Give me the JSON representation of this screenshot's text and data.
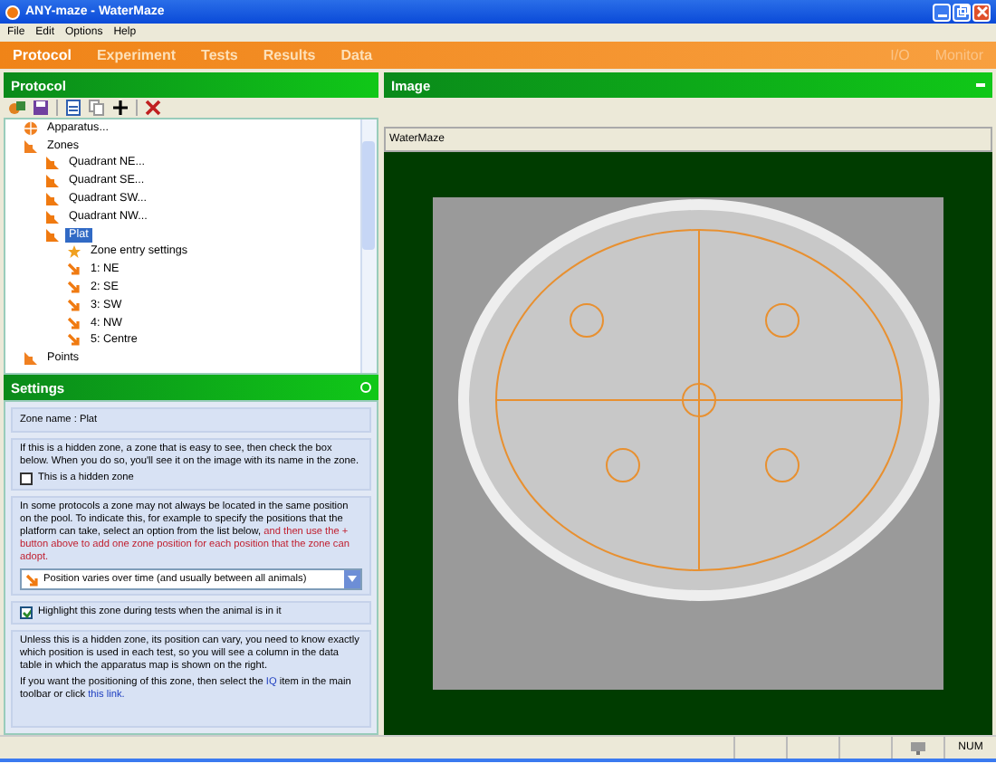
{
  "window": {
    "title": "ANY-maze - WaterMaze"
  },
  "menu": [
    "File",
    "Edit",
    "Options",
    "Help"
  ],
  "tabs": [
    {
      "label": "Protocol",
      "selected": true,
      "disabled": false
    },
    {
      "label": "Experiment",
      "selected": false,
      "disabled": false
    },
    {
      "label": "Tests",
      "selected": false,
      "disabled": false
    },
    {
      "label": "Results",
      "selected": false,
      "disabled": false
    },
    {
      "label": "Data",
      "selected": false,
      "disabled": false
    }
  ],
  "right_tabs": [
    {
      "label": "I/O",
      "disabled": true
    },
    {
      "label": "Monitor",
      "disabled": true
    }
  ],
  "protocol_panel": {
    "title": "Protocol",
    "tree": [
      {
        "label": "Apparatus...",
        "kind": "apparatus",
        "selected": false
      },
      {
        "label": "Zones",
        "kind": "folder",
        "selected": false,
        "children": [
          {
            "label": "Quadrant NE...",
            "kind": "zone",
            "selected": false
          },
          {
            "label": "Quadrant SE...",
            "kind": "zone",
            "selected": false
          },
          {
            "label": "Quadrant SW...",
            "kind": "zone",
            "selected": false
          },
          {
            "label": "Quadrant NW...",
            "kind": "zone",
            "selected": false
          },
          {
            "label": "Plat",
            "kind": "zone",
            "selected": true,
            "children": [
              {
                "label": "Zone entry settings",
                "kind": "setting",
                "selected": false
              },
              {
                "label": "1: NE",
                "kind": "position",
                "selected": false
              },
              {
                "label": "2: SE",
                "kind": "position",
                "selected": false
              },
              {
                "label": "3: SW",
                "kind": "position",
                "selected": false
              },
              {
                "label": "4: NW",
                "kind": "position",
                "selected": false
              },
              {
                "label": "5: Centre",
                "kind": "position",
                "selected": false
              }
            ]
          }
        ]
      },
      {
        "label": "Points",
        "kind": "folder",
        "selected": false
      }
    ]
  },
  "settings_panel": {
    "title": "Settings",
    "zone_name": "Zone name : Plat",
    "hidden_text": "If this is a hidden zone, a zone that is easy to see, then check the box below. When you do so, you'll see it on the image with its name in the zone.",
    "hidden_checkbox": {
      "label": "This is a hidden zone",
      "checked": false
    },
    "position_text": "In some protocols a zone may not always be located in the same position on the pool. To indicate this, for example to specify the positions that the platform can take, select an option from the list below, **and then use the + button above to add one zone position for each position that the zone can adopt.**",
    "position_dropdown": "Position varies over time (and usually between all animals)",
    "highlight_checkbox": {
      "label": "Highlight this zone during tests when the animal is in it",
      "checked": true
    },
    "info_text": "Unless this is a hidden zone, its position can vary, you need to know exactly which position is used in each test, so you will see a column in the data table in which the apparatus map is shown on the right.",
    "link_text_before": "If you want the positioning of this zone, then select the ",
    "link_icon_text": "IQ",
    "link_text_middle": " item in the main toolbar or click ",
    "link": "this link."
  },
  "image_panel": {
    "title": "Image",
    "view_title": "WaterMaze"
  },
  "status_bar": [
    "NUM"
  ]
}
